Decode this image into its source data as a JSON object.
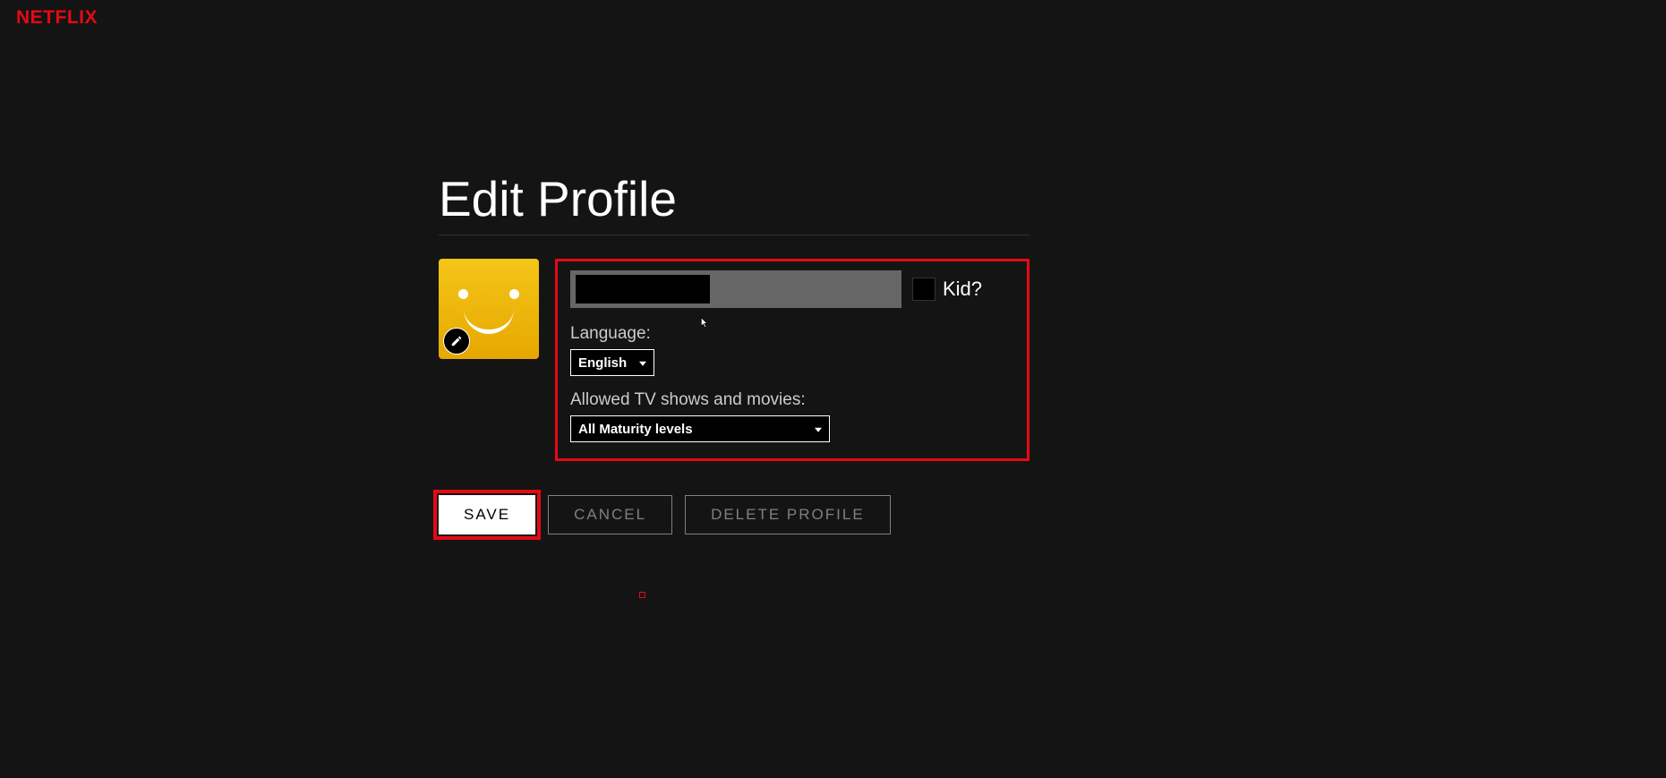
{
  "brand": "NETFLIX",
  "page": {
    "title": "Edit Profile"
  },
  "form": {
    "name_value": "",
    "kid_label": "Kid?",
    "language_label": "Language:",
    "language_value": "English",
    "maturity_label": "Allowed TV shows and movies:",
    "maturity_value": "All Maturity levels"
  },
  "buttons": {
    "save": "SAVE",
    "cancel": "CANCEL",
    "delete": "DELETE PROFILE"
  }
}
